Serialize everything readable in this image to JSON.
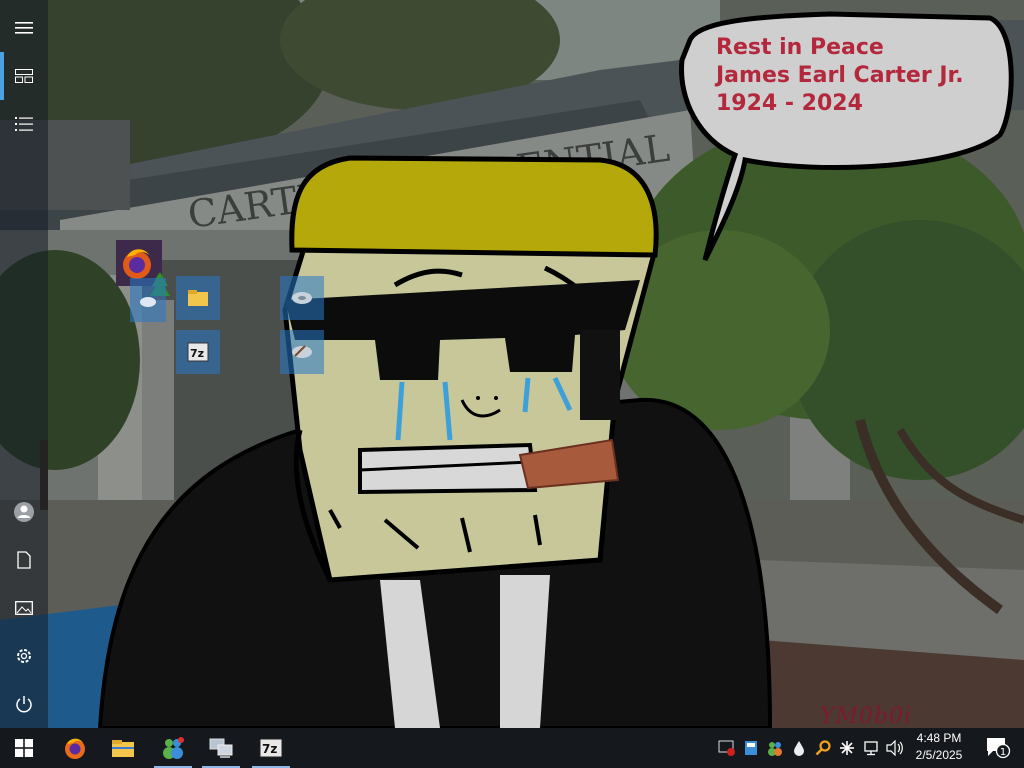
{
  "wallpaper": {
    "building_sign": "CARTER PRESIDENTIAL",
    "bubble_lines": [
      "Rest in Peace",
      "James Earl Carter Jr.",
      "1924 - 2024"
    ],
    "watermark": "YM0b0i"
  },
  "start_rail": {
    "items": [
      {
        "name": "Expand",
        "icon": "hamburger-icon"
      },
      {
        "name": "Pinned tiles",
        "icon": "tiles-icon"
      },
      {
        "name": "All apps",
        "icon": "list-icon"
      },
      {
        "name": "Account",
        "icon": "user-icon"
      },
      {
        "name": "Documents",
        "icon": "document-icon"
      },
      {
        "name": "Pictures",
        "icon": "pictures-icon"
      },
      {
        "name": "Settings",
        "icon": "gear-icon"
      },
      {
        "name": "Power",
        "icon": "power-icon"
      }
    ]
  },
  "start_tiles": [
    {
      "app": "Firefox",
      "icon": "firefox-icon"
    },
    {
      "app": "Weather",
      "icon": "weather-icon"
    },
    {
      "app": "File Explorer",
      "icon": "folder-icon"
    },
    {
      "app": "7-Zip",
      "icon": "7zip-icon"
    },
    {
      "app": "Disk utility",
      "icon": "disk-icon"
    },
    {
      "app": "Disk cleanup",
      "icon": "disk-cleanup-icon"
    }
  ],
  "taskbar": {
    "pinned": [
      {
        "app": "Firefox",
        "icon": "firefox-icon",
        "active": false
      },
      {
        "app": "File Explorer",
        "icon": "folder-icon",
        "active": false
      },
      {
        "app": "Windows Messenger",
        "icon": "messenger-icon",
        "active": true
      },
      {
        "app": "Network",
        "icon": "network-computers-icon",
        "active": true
      },
      {
        "app": "7-Zip",
        "icon": "7zip-icon",
        "active": true
      }
    ],
    "tray_icons": [
      "security-alert-icon",
      "removable-drive-icon",
      "messenger-tray-icon",
      "water-drop-icon",
      "search-magnifier-icon",
      "asterisk-icon",
      "network-icon",
      "volume-icon"
    ],
    "clock": {
      "time": "4:48 PM",
      "date": "2/5/2025"
    },
    "notifications": {
      "count": "1"
    }
  },
  "colors": {
    "bubble_text": "#b3283c",
    "accent": "#4aa3e0",
    "taskbar": "#15181c"
  }
}
